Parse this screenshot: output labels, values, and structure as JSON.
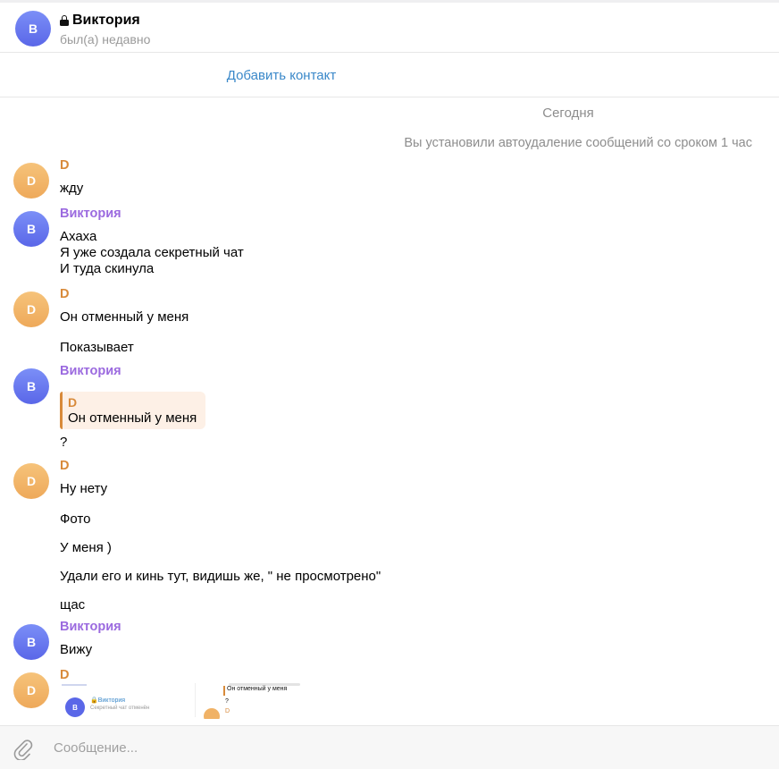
{
  "header": {
    "avatar_letter": "В",
    "name": "Виктория",
    "status": "был(а) недавно",
    "lock_icon": "lock-icon"
  },
  "add_contact": {
    "label": "Добавить контакт"
  },
  "chat": {
    "date_separator": "Сегодня",
    "service_message": "Вы установили автоудаление сообщений со сроком 1 час",
    "groups": [
      {
        "avatar_letter": "D",
        "sender": "D",
        "lines": [
          "жду"
        ]
      },
      {
        "avatar_letter": "В",
        "sender": "Виктория",
        "lines": [
          "Ахаха",
          "Я уже создала секретный чат",
          "И туда скинула"
        ]
      },
      {
        "avatar_letter": "D",
        "sender": "D",
        "lines": [
          "Он отменный у меня",
          "Показывает"
        ]
      },
      {
        "avatar_letter": "В",
        "sender": "Виктория",
        "reply": {
          "name": "D",
          "text": "Он отменный у меня"
        },
        "lines": [
          "?"
        ]
      },
      {
        "avatar_letter": "D",
        "sender": "D",
        "lines": [
          "Ну нету",
          "Фото",
          "У меня )",
          "Удали его и кинь тут, видишь же, \" не просмотрено\"",
          "щас"
        ]
      },
      {
        "avatar_letter": "В",
        "sender": "Виктория",
        "lines": [
          "Вижу"
        ]
      },
      {
        "avatar_letter": "D",
        "sender": "D",
        "screenshot": {
          "avatar_letter": "В",
          "name": "Виктория",
          "status": "Секретный чат отменён",
          "reply_text": "Он отменный у меня",
          "question": "?",
          "d_name": "D"
        }
      }
    ]
  },
  "composer": {
    "placeholder": "Сообщение...",
    "attach_icon": "paperclip-icon"
  },
  "colors": {
    "accent_link": "#3a88c9",
    "sender_d": "#d88a3a",
    "sender_v": "#9b6adf"
  }
}
